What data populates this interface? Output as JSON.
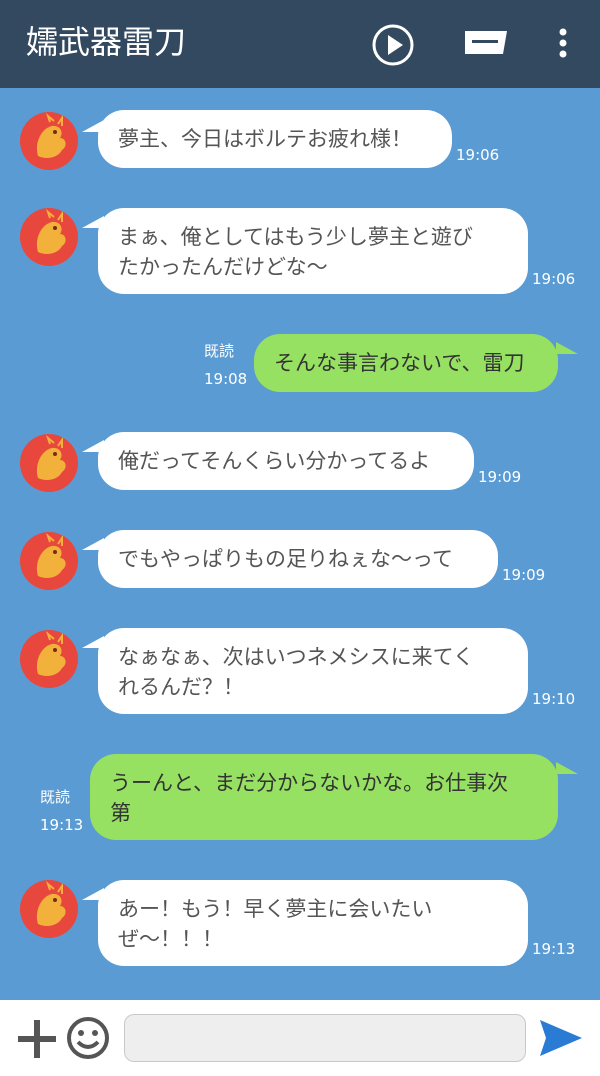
{
  "header": {
    "title": "嬬武器雷刀",
    "icons": [
      "play-icon",
      "message-icon",
      "more-vert-icon"
    ]
  },
  "messages": [
    {
      "side": "in",
      "text": "夢主、今日はボルテお疲れ様！",
      "time": "19:06"
    },
    {
      "side": "in",
      "text": "まぁ、俺としてはもう少し夢主と遊び\nたかったんだけどな〜",
      "time": "19:06"
    },
    {
      "side": "out",
      "text": "そんな事言わないで、雷刀",
      "time": "19:08",
      "read": "既読"
    },
    {
      "side": "in",
      "text": "俺だってそんくらい分かってるよ",
      "time": "19:09"
    },
    {
      "side": "in",
      "text": "でもやっぱりもの足りねぇな〜って",
      "time": "19:09"
    },
    {
      "side": "in",
      "text": "なぁなぁ、次はいつネメシスに来てく\nれるんだ？！",
      "time": "19:10"
    },
    {
      "side": "out",
      "text": "うーんと、まだ分からないかな。お仕事次\n第",
      "time": "19:13",
      "read": "既読"
    },
    {
      "side": "in",
      "text": "あー！もう！早く夢主に会いたい\nぜ〜！！！",
      "time": "19:13"
    }
  ],
  "footer": {
    "input_value": "",
    "icons": [
      "plus-icon",
      "emoji-icon",
      "send-icon"
    ]
  },
  "colors": {
    "header_bg": "#33495f",
    "chat_bg": "#5b9bd3",
    "incoming_bubble": "#ffffff",
    "outgoing_bubble": "#96e062",
    "send_icon": "#2a7bd4"
  }
}
